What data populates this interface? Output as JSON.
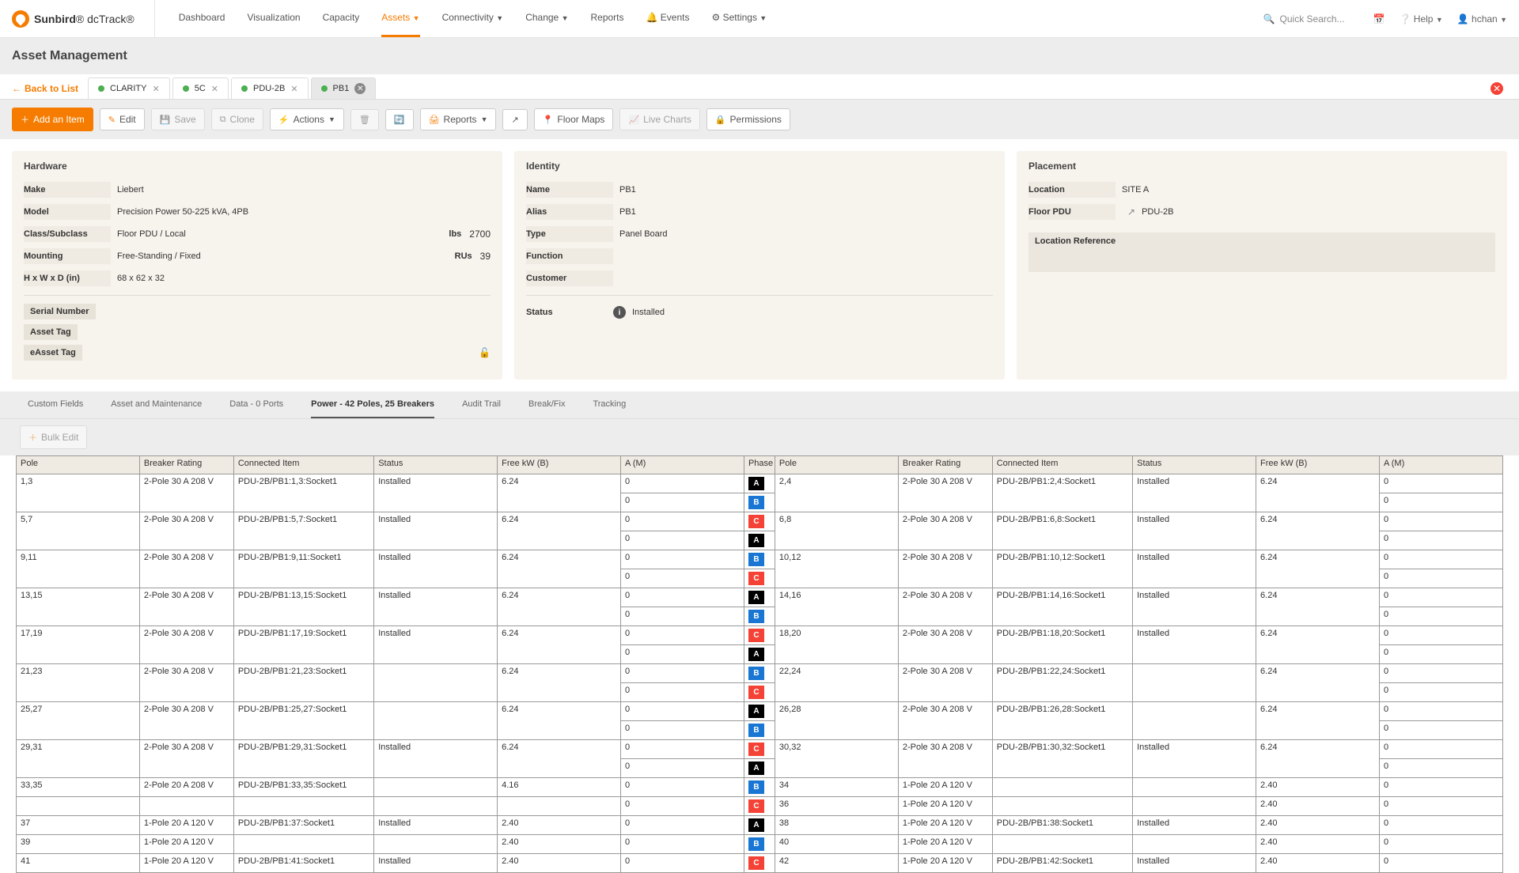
{
  "brand": {
    "name1": "Sunbird",
    "name2": "dcTrack",
    "reg": "®"
  },
  "nav": {
    "items": [
      "Dashboard",
      "Visualization",
      "Capacity",
      "Assets",
      "Connectivity",
      "Change",
      "Reports",
      "Events",
      "Settings"
    ],
    "active": 3
  },
  "topright": {
    "search_ph": "Quick Search...",
    "help": "Help",
    "user": "hchan"
  },
  "page_title": "Asset Management",
  "back": "Back to List",
  "file_tabs": [
    {
      "label": "CLARITY"
    },
    {
      "label": "5C"
    },
    {
      "label": "PDU-2B"
    },
    {
      "label": "PB1",
      "active": true
    }
  ],
  "toolbar": {
    "add": "Add an Item",
    "edit": "Edit",
    "save": "Save",
    "clone": "Clone",
    "actions": "Actions",
    "reports": "Reports",
    "floor_maps": "Floor Maps",
    "live_charts": "Live Charts",
    "permissions": "Permissions"
  },
  "hardware": {
    "title": "Hardware",
    "make_l": "Make",
    "make_v": "Liebert",
    "model_l": "Model",
    "model_v": "Precision Power 50-225 kVA, 4PB",
    "class_l": "Class/Subclass",
    "class_v": "Floor PDU / Local",
    "lbs_l": "lbs",
    "lbs_v": "2700",
    "mount_l": "Mounting",
    "mount_v": "Free-Standing / Fixed",
    "rus_l": "RUs",
    "rus_v": "39",
    "dim_l": "H x W x D (in)",
    "dim_v": "68 x 62 x 32",
    "serial_l": "Serial Number",
    "asset_l": "Asset Tag",
    "easset_l": "eAsset Tag"
  },
  "identity": {
    "title": "Identity",
    "name_l": "Name",
    "name_v": "PB1",
    "alias_l": "Alias",
    "alias_v": "PB1",
    "type_l": "Type",
    "type_v": "Panel Board",
    "func_l": "Function",
    "cust_l": "Customer",
    "status_l": "Status",
    "status_v": "Installed"
  },
  "placement": {
    "title": "Placement",
    "loc_l": "Location",
    "loc_v": "SITE A",
    "fpdu_l": "Floor PDU",
    "fpdu_v": "PDU-2B",
    "locref_l": "Location Reference"
  },
  "sub_tabs": [
    "Custom Fields",
    "Asset and Maintenance",
    "Data - 0 Ports",
    "Power - 42 Poles, 25 Breakers",
    "Audit Trail",
    "Break/Fix",
    "Tracking"
  ],
  "sub_active": 3,
  "bulk_edit": "Bulk Edit",
  "grid": {
    "headers": [
      "Pole",
      "Breaker Rating",
      "Connected Item",
      "Status",
      "Free kW (B)",
      "A (M)",
      "Phase",
      "Pole",
      "Breaker Rating",
      "Connected Item",
      "Status",
      "Free kW (B)",
      "A (M)"
    ],
    "rows": [
      {
        "l": {
          "pole": "1,3",
          "br": "2-Pole 30 A 208 V",
          "ci": "PDU-2B/PB1:1,3:Socket1",
          "st": "Installed",
          "kw": "6.24",
          "am": "0"
        },
        "ph1": "A",
        "r": {
          "pole": "2,4",
          "br": "2-Pole 30 A 208 V",
          "ci": "PDU-2B/PB1:2,4:Socket1",
          "st": "Installed",
          "kw": "6.24",
          "am": "0"
        }
      },
      {
        "l": {
          "am": "0"
        },
        "ph1": "B",
        "r": {
          "am": "0"
        }
      },
      {
        "l": {
          "pole": "5,7",
          "br": "2-Pole 30 A 208 V",
          "ci": "PDU-2B/PB1:5,7:Socket1",
          "st": "Installed",
          "kw": "6.24",
          "am": "0"
        },
        "ph1": "C",
        "r": {
          "pole": "6,8",
          "br": "2-Pole 30 A 208 V",
          "ci": "PDU-2B/PB1:6,8:Socket1",
          "st": "Installed",
          "kw": "6.24",
          "am": "0"
        }
      },
      {
        "l": {
          "am": "0"
        },
        "ph1": "A",
        "r": {
          "am": "0"
        }
      },
      {
        "l": {
          "pole": "9,11",
          "br": "2-Pole 30 A 208 V",
          "ci": "PDU-2B/PB1:9,11:Socket1",
          "st": "Installed",
          "kw": "6.24",
          "am": "0"
        },
        "ph1": "B",
        "r": {
          "pole": "10,12",
          "br": "2-Pole 30 A 208 V",
          "ci": "PDU-2B/PB1:10,12:Socket1",
          "st": "Installed",
          "kw": "6.24",
          "am": "0"
        }
      },
      {
        "l": {
          "am": "0"
        },
        "ph1": "C",
        "r": {
          "am": "0"
        }
      },
      {
        "l": {
          "pole": "13,15",
          "br": "2-Pole 30 A 208 V",
          "ci": "PDU-2B/PB1:13,15:Socket1",
          "st": "Installed",
          "kw": "6.24",
          "am": "0"
        },
        "ph1": "A",
        "r": {
          "pole": "14,16",
          "br": "2-Pole 30 A 208 V",
          "ci": "PDU-2B/PB1:14,16:Socket1",
          "st": "Installed",
          "kw": "6.24",
          "am": "0"
        }
      },
      {
        "l": {
          "am": "0"
        },
        "ph1": "B",
        "r": {
          "am": "0"
        }
      },
      {
        "l": {
          "pole": "17,19",
          "br": "2-Pole 30 A 208 V",
          "ci": "PDU-2B/PB1:17,19:Socket1",
          "st": "Installed",
          "kw": "6.24",
          "am": "0"
        },
        "ph1": "C",
        "r": {
          "pole": "18,20",
          "br": "2-Pole 30 A 208 V",
          "ci": "PDU-2B/PB1:18,20:Socket1",
          "st": "Installed",
          "kw": "6.24",
          "am": "0"
        }
      },
      {
        "l": {
          "am": "0"
        },
        "ph1": "A",
        "r": {
          "am": "0"
        }
      },
      {
        "l": {
          "pole": "21,23",
          "br": "2-Pole 30 A 208 V",
          "ci": "PDU-2B/PB1:21,23:Socket1",
          "st": "",
          "kw": "6.24",
          "am": "0"
        },
        "ph1": "B",
        "r": {
          "pole": "22,24",
          "br": "2-Pole 30 A 208 V",
          "ci": "PDU-2B/PB1:22,24:Socket1",
          "st": "",
          "kw": "6.24",
          "am": "0"
        }
      },
      {
        "l": {
          "am": "0"
        },
        "ph1": "C",
        "r": {
          "am": "0"
        }
      },
      {
        "l": {
          "pole": "25,27",
          "br": "2-Pole 30 A 208 V",
          "ci": "PDU-2B/PB1:25,27:Socket1",
          "st": "",
          "kw": "6.24",
          "am": "0"
        },
        "ph1": "A",
        "r": {
          "pole": "26,28",
          "br": "2-Pole 30 A 208 V",
          "ci": "PDU-2B/PB1:26,28:Socket1",
          "st": "",
          "kw": "6.24",
          "am": "0"
        }
      },
      {
        "l": {
          "am": "0"
        },
        "ph1": "B",
        "r": {
          "am": "0"
        }
      },
      {
        "l": {
          "pole": "29,31",
          "br": "2-Pole 30 A 208 V",
          "ci": "PDU-2B/PB1:29,31:Socket1",
          "st": "Installed",
          "kw": "6.24",
          "am": "0"
        },
        "ph1": "C",
        "r": {
          "pole": "30,32",
          "br": "2-Pole 30 A 208 V",
          "ci": "PDU-2B/PB1:30,32:Socket1",
          "st": "Installed",
          "kw": "6.24",
          "am": "0"
        }
      },
      {
        "l": {
          "am": "0"
        },
        "ph1": "A",
        "r": {
          "am": "0"
        }
      },
      {
        "l": {
          "pole": "33,35",
          "br": "2-Pole 20 A 208 V",
          "ci": "PDU-2B/PB1:33,35:Socket1",
          "st": "",
          "kw": "4.16",
          "am": "0"
        },
        "ph1": "B",
        "r": {
          "pole": "34",
          "br": "1-Pole 20 A 120 V",
          "ci": "",
          "st": "",
          "kw": "2.40",
          "am": "0"
        }
      },
      {
        "l": {
          "am": "0"
        },
        "ph1": "C",
        "r": {
          "pole": "36",
          "br": "1-Pole 20 A 120 V",
          "ci": "",
          "st": "",
          "kw": "2.40",
          "am": "0"
        }
      },
      {
        "l": {
          "pole": "37",
          "br": "1-Pole 20 A 120 V",
          "ci": "PDU-2B/PB1:37:Socket1",
          "st": "Installed",
          "kw": "2.40",
          "am": "0"
        },
        "ph1": "A",
        "r": {
          "pole": "38",
          "br": "1-Pole 20 A 120 V",
          "ci": "PDU-2B/PB1:38:Socket1",
          "st": "Installed",
          "kw": "2.40",
          "am": "0"
        }
      },
      {
        "l": {
          "pole": "39",
          "br": "1-Pole 20 A 120 V",
          "ci": "",
          "st": "",
          "kw": "2.40",
          "am": "0"
        },
        "ph1": "B",
        "r": {
          "pole": "40",
          "br": "1-Pole 20 A 120 V",
          "ci": "",
          "st": "",
          "kw": "2.40",
          "am": "0"
        }
      },
      {
        "l": {
          "pole": "41",
          "br": "1-Pole 20 A 120 V",
          "ci": "PDU-2B/PB1:41:Socket1",
          "st": "Installed",
          "kw": "2.40",
          "am": "0"
        },
        "ph1": "C",
        "r": {
          "pole": "42",
          "br": "1-Pole 20 A 120 V",
          "ci": "PDU-2B/PB1:42:Socket1",
          "st": "Installed",
          "kw": "2.40",
          "am": "0"
        }
      }
    ]
  }
}
